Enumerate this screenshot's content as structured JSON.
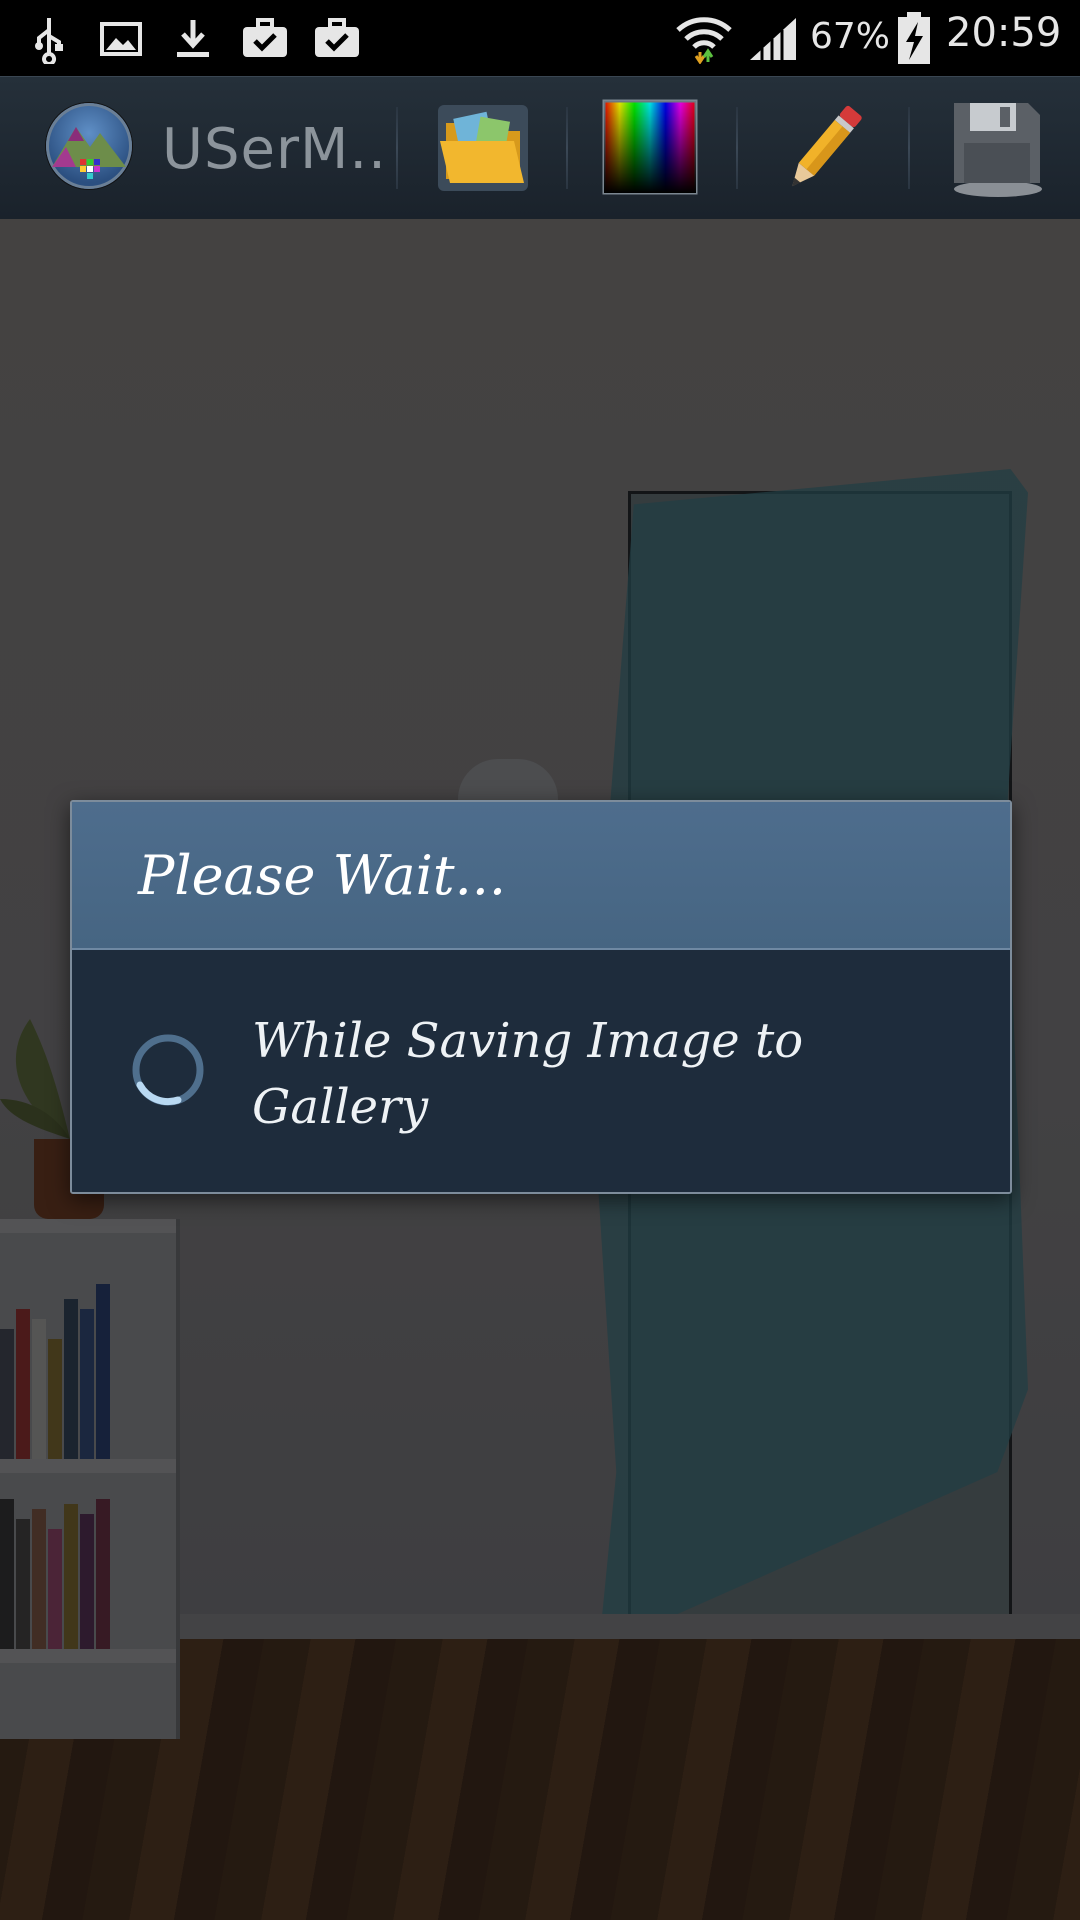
{
  "status_bar": {
    "battery_percent": "67%",
    "time": "20:59",
    "icons": [
      "usb-icon",
      "image-icon",
      "download-icon",
      "briefcase-check-icon",
      "briefcase-check-icon",
      "wifi-icon",
      "signal-icon",
      "battery-charging-icon"
    ]
  },
  "app_bar": {
    "title": "USerM..",
    "actions": [
      "open-folder-icon",
      "color-picker-icon",
      "pencil-icon",
      "save-disk-icon"
    ]
  },
  "dialog": {
    "title": "Please Wait...",
    "message": "While Saving Image to Gallery"
  }
}
